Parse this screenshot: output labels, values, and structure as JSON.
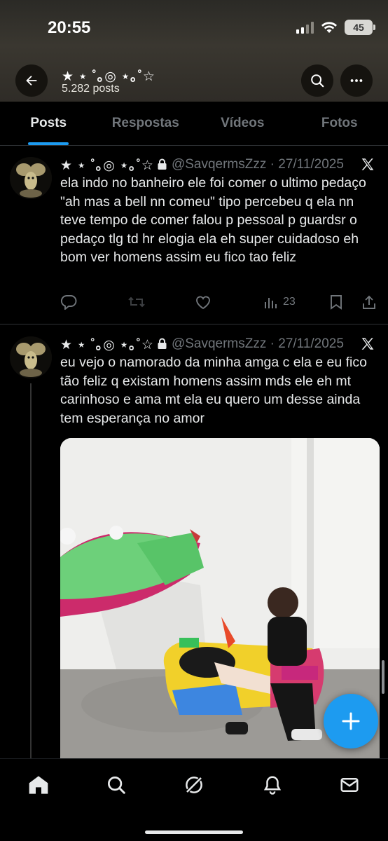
{
  "status_bar": {
    "time": "20:55",
    "battery": "45"
  },
  "header": {
    "title": "★ ⋆ ˚｡◎ ⋆｡˚☆",
    "post_count": "5.282 posts"
  },
  "tabs": [
    {
      "label": "Posts",
      "active": true
    },
    {
      "label": "Respostas",
      "active": false
    },
    {
      "label": "Vídeos",
      "active": false
    },
    {
      "label": "Fotos",
      "active": false
    }
  ],
  "posts": [
    {
      "display_name": "★ ⋆ ˚｡◎ ⋆｡˚☆",
      "handle": "@SavqermsZzz",
      "date": "27/11/2025",
      "text": "ela indo no banheiro ele foi comer o ultimo pedaço \"ah mas a bell nn comeu\" tipo percebeu q ela nn teve tempo de comer falou p pessoal p guardsr o pedaço tlg td hr elogia ela eh super cuidadoso eh bom ver homens assim eu fico tao feliz",
      "views": "23"
    },
    {
      "display_name": "★ ⋆ ˚｡◎ ⋆｡˚☆",
      "handle": "@SavqermsZzz",
      "date": "27/11/2025",
      "text": "eu vejo o namorado da minha amga c ela e eu fico tão feliz q existam homens assim mds ele eh mt carinhoso e ama mt ela eu quero um desse ainda tem esperança no amor"
    }
  ],
  "colors": {
    "accent": "#1d9bf0",
    "muted": "#71767b",
    "text": "#e7e9ea",
    "background": "#000000"
  }
}
